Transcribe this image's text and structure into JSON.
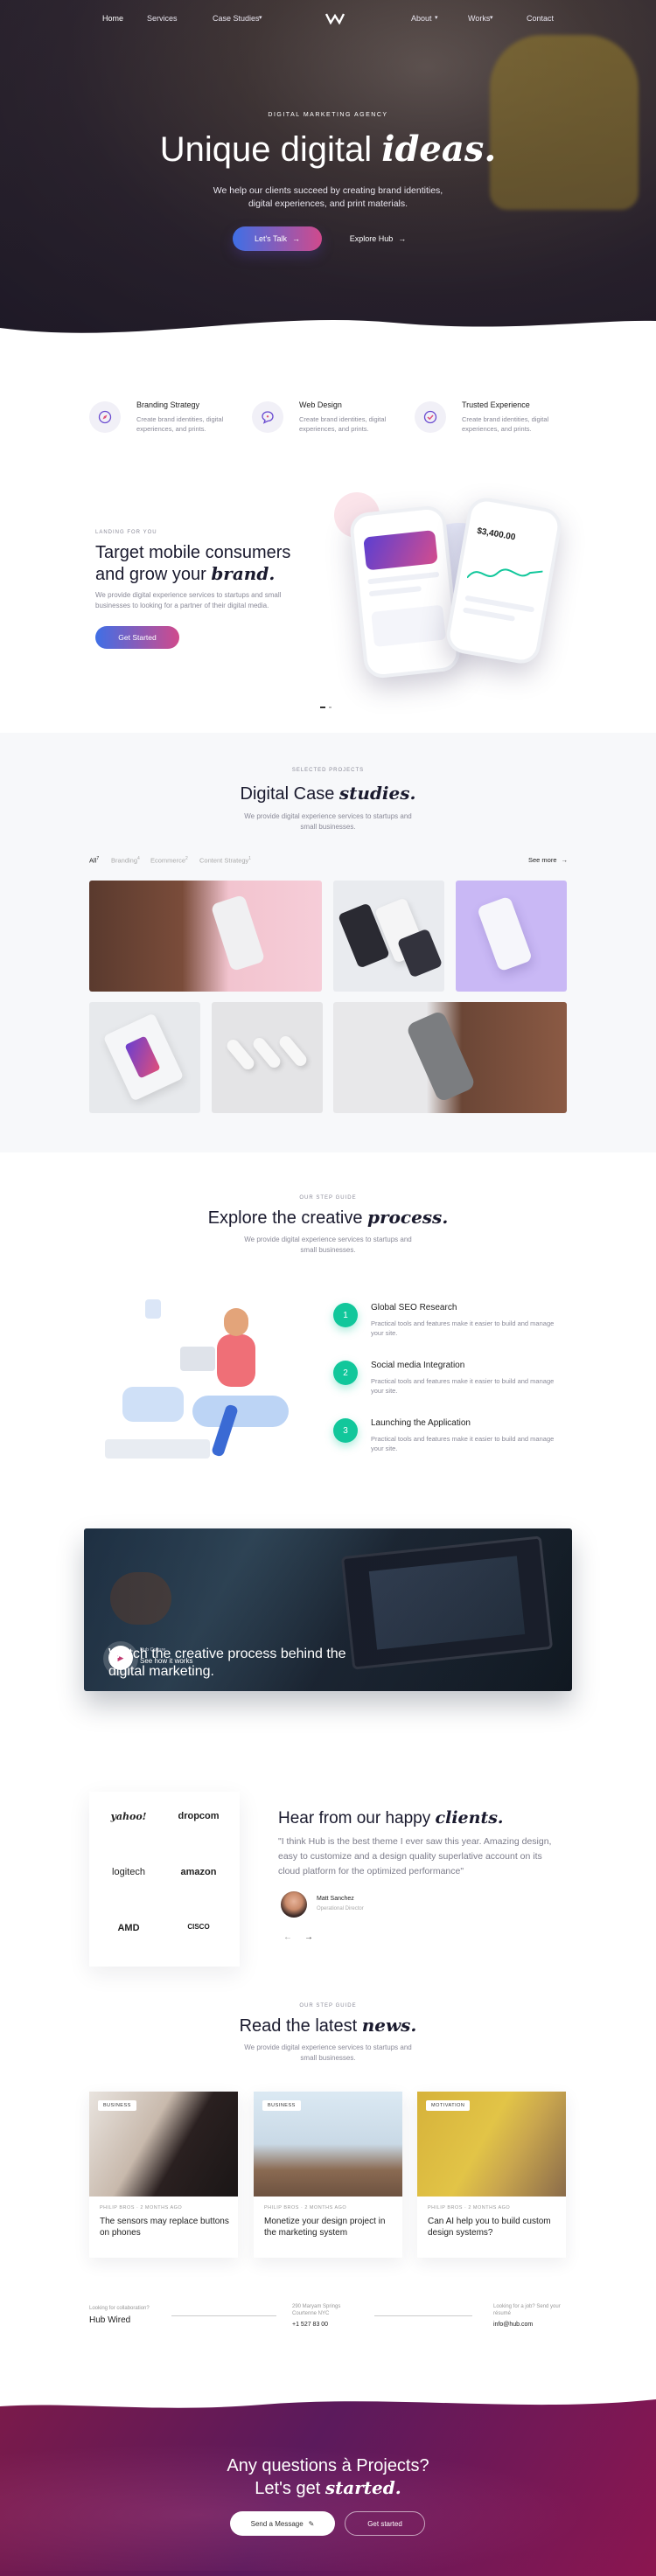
{
  "nav": {
    "items": [
      "Home",
      "Services",
      "Case Studies",
      "About",
      "Works",
      "Contact"
    ]
  },
  "hero": {
    "eyebrow": "Digital Marketing Agency",
    "title_plain": "Unique digital",
    "title_italic": "ideas.",
    "subtitle": "We help our clients succeed by creating brand identities, digital experiences, and print materials.",
    "btn_primary": "Let's Talk",
    "btn_secondary": "Explore Hub"
  },
  "features": [
    {
      "title": "Branding Strategy",
      "desc": "Create brand identities, digital experiences, and prints.",
      "icon": "compass-icon"
    },
    {
      "title": "Web Design",
      "desc": "Create brand identities, digital experiences, and prints.",
      "icon": "chat-icon"
    },
    {
      "title": "Trusted Experience",
      "desc": "Create brand identities, digital experiences, and prints.",
      "icon": "check-icon"
    }
  ],
  "mobile": {
    "eyebrow": "Landing For You",
    "title_line1": "Target mobile consumers",
    "title_line2": "and grow your",
    "title_italic": "brand.",
    "desc": "We provide digital experience services to startups and small businesses to looking for a partner of their digital media.",
    "button": "Get Started",
    "phone_amount": "$3,400.00"
  },
  "cases": {
    "eyebrow": "Selected Projects",
    "title_plain": "Digital Case",
    "title_italic": "studies.",
    "desc": "We provide digital experience services to startups and small businesses.",
    "filters": [
      {
        "label": "All",
        "count": "7"
      },
      {
        "label": "Branding",
        "count": "4"
      },
      {
        "label": "Ecommerce",
        "count": "2"
      },
      {
        "label": "Content Strategy",
        "count": "1"
      }
    ],
    "see_more": "See more"
  },
  "process": {
    "eyebrow": "Our Step Guide",
    "title_plain": "Explore the creative",
    "title_italic": "process.",
    "desc": "We provide digital experience services to startups and small businesses.",
    "steps": [
      {
        "num": "1",
        "title": "Global SEO Research",
        "desc": "Practical tools and features make it easier to build and manage your site."
      },
      {
        "num": "2",
        "title": "Social media Integration",
        "desc": "Practical tools and features make it easier to build and manage your site."
      },
      {
        "num": "3",
        "title": "Launching the Application",
        "desc": "Practical tools and features make it easier to build and manage your site."
      }
    ]
  },
  "video": {
    "title_line1": "Watch the creative process behind the",
    "title_line2": "digital marketing.",
    "small_label": "Hub Culture",
    "link": "See how it works"
  },
  "testimonial": {
    "logos": [
      "yahoo!",
      "dropcom",
      "logitech",
      "amazon",
      "AMD",
      "CISCO"
    ],
    "title_plain": "Hear from our happy",
    "title_italic": "clients.",
    "quote": "\"I think Hub is the best theme I ever saw this year. Amazing design, easy to customize and a design quality superlative account on its cloud platform for the optimized performance\"",
    "author": "Matt Sanchez",
    "role": "Operational Director"
  },
  "news": {
    "eyebrow": "Our Step Guide",
    "title_plain": "Read the latest",
    "title_italic": "news.",
    "desc": "We provide digital experience services to startups and small businesses.",
    "cards": [
      {
        "tag": "BUSINESS",
        "meta": "PHILIP BROS · 2 MONTHS AGO",
        "title": "The sensors may replace buttons on phones"
      },
      {
        "tag": "BUSINESS",
        "meta": "PHILIP BROS · 2 MONTHS AGO",
        "title": "Monetize your design project in the marketing system"
      },
      {
        "tag": "MOTIVATION",
        "meta": "PHILIP BROS · 2 MONTHS AGO",
        "title": "Can AI help you to build custom design systems?"
      }
    ]
  },
  "contact": {
    "col1_label": "Looking for collaboration?",
    "col1_value": "Hub Wired",
    "col2_label": "290 Maryam Springs Courtenne NYC",
    "col2_value": "+1 527 83 00",
    "col3_label": "Looking for a job? Send your résumé",
    "col3_value": "info@hub.com"
  },
  "footer": {
    "line1": "Any questions à Projects?",
    "line2_plain": "Let's get",
    "line2_italic": "started.",
    "btn_message": "Send a Message",
    "btn_start": "Get started"
  },
  "colors": {
    "accent_blue": "#3f6fe6",
    "accent_pink": "#d04a8c",
    "green": "#11c79b",
    "footer": "#6b1a55"
  }
}
